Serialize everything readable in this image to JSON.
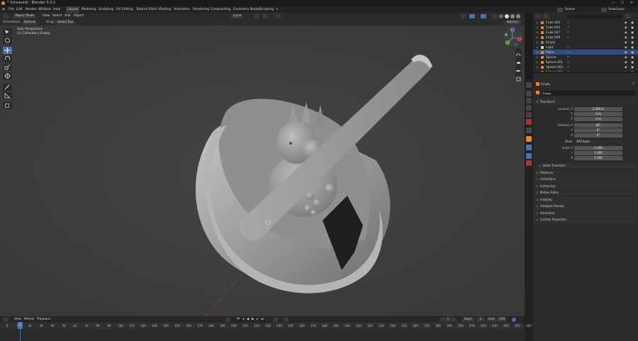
{
  "window": {
    "title": "* (Unsaved) - Blender 5.0.1",
    "controls": [
      "—",
      "☐",
      "✕"
    ]
  },
  "menu": [
    "File",
    "Edit",
    "Render",
    "Window",
    "Help"
  ],
  "workspaces": [
    "Layout",
    "Modeling",
    "Sculpting",
    "UV Editing",
    "Texture Paint",
    "Shading",
    "Animation",
    "Rendering",
    "Compositing",
    "Geometry Nodes",
    "Scripting",
    "+"
  ],
  "scene": {
    "scene_label": "Scene",
    "view_layer": "ViewLayer"
  },
  "viewport_header": {
    "mode": "Object Mode",
    "menus": [
      "View",
      "Select",
      "Add",
      "Object"
    ],
    "transform_space": "Local"
  },
  "tool_header": {
    "orientation_label": "Orientation:",
    "orientation_value": "Default",
    "drag_label": "Drag:",
    "drag_value": "Select Box",
    "options": "Options"
  },
  "viewport_info": {
    "perspective": "User Perspective",
    "collection": "(1) Collection | Empty"
  },
  "gizmo": {
    "x": "X",
    "y": "Y",
    "z": "Z"
  },
  "outliner": {
    "search_placeholder": "",
    "items": [
      {
        "name": "Cube.003",
        "type": "mesh",
        "selected": false,
        "modifier": true
      },
      {
        "name": "Cube.004",
        "type": "mesh",
        "selected": false,
        "modifier": true
      },
      {
        "name": "Cube.007",
        "type": "mesh",
        "selected": false,
        "modifier": true
      },
      {
        "name": "Cube.008",
        "type": "mesh",
        "selected": false,
        "modifier": true
      },
      {
        "name": "Empty",
        "type": "empty",
        "selected": false,
        "modifier": false
      },
      {
        "name": "Light",
        "type": "light",
        "selected": false,
        "modifier": true
      },
      {
        "name": "Plane",
        "type": "mesh",
        "selected": true,
        "modifier": true
      },
      {
        "name": "Sphere",
        "type": "mesh",
        "selected": false,
        "modifier": true
      },
      {
        "name": "Sphere.001",
        "type": "mesh",
        "selected": false,
        "modifier": true
      },
      {
        "name": "Sphere.002",
        "type": "mesh",
        "selected": false,
        "modifier": true
      },
      {
        "name": "Sphere.003",
        "type": "mesh",
        "selected": false,
        "modifier": true
      }
    ]
  },
  "properties": {
    "object_name": "Empty",
    "object_field": "Empty",
    "transform_title": "Transform",
    "location": {
      "label": "Location X",
      "x": "2.488 m",
      "y_label": "Y",
      "y": "0 m",
      "z_label": "Z",
      "z": "0 m"
    },
    "rotation": {
      "label": "Rotation X",
      "x": "92°",
      "y_label": "Y",
      "y": "0°",
      "z_label": "Z",
      "z": "0°"
    },
    "mode": {
      "label": "Mode",
      "value": "XYZ Euler"
    },
    "scale": {
      "label": "Scale X",
      "x": "1.000",
      "y_label": "Y",
      "y": "1.000",
      "z_label": "Z",
      "z": "1.000"
    },
    "panels": [
      "Delta Transform",
      "Relations",
      "Collections",
      "Instancing",
      "Motion Paths",
      "Visibility",
      "Viewport Display",
      "Animation",
      "Custom Properties"
    ]
  },
  "timeline": {
    "menus": [
      "View",
      "Marker",
      "Playback"
    ],
    "current_frame": "1",
    "start_label": "Start",
    "start": "1",
    "end_label": "End",
    "end": "250",
    "playhead": "1",
    "ruler": [
      "0",
      "12",
      "22",
      "30",
      "40",
      "50",
      "62",
      "70",
      "80",
      "90",
      "100",
      "110",
      "120",
      "130",
      "140",
      "150",
      "160",
      "170",
      "180",
      "190",
      "200",
      "210",
      "220",
      "230",
      "240",
      "250",
      "260",
      "270",
      "280",
      "290",
      "300",
      "310",
      "320",
      "330",
      "340",
      "350",
      "360",
      "370",
      "380",
      "390",
      "400",
      "410",
      "420",
      "430",
      "440",
      "450",
      "460"
    ]
  },
  "colors": {
    "accent": "#4772b3",
    "selected_row": "#334d80",
    "mesh_icon": "#e8892f",
    "modifier": "#5fb85f",
    "empty_icon": "#8e8e8e",
    "light_icon": "#e7e05a"
  }
}
